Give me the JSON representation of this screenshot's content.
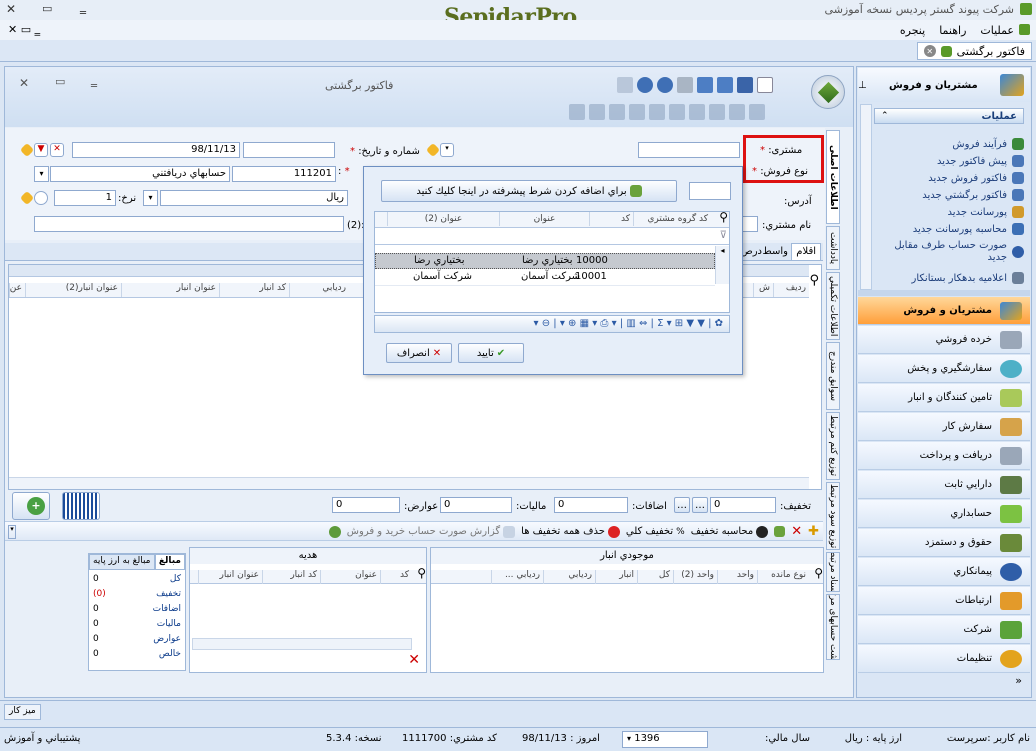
{
  "app": {
    "brand": "SepidarPro",
    "window_title": "شرکت پیوند گستر پردیس نسخه آموزشی",
    "menu": [
      "عملیات",
      "راهنما",
      "پنجره"
    ],
    "doc_tab": "فاکتور برگشتی"
  },
  "form": {
    "title": "فاکتور برگشتی",
    "customer_label": "مشتری:",
    "sale_type_label": "نوع فروش:",
    "address_label": "آدرس:",
    "customer_name_label": "نام مشتري:",
    "number_date_label": "شماره و تاریخ:",
    "date": "98/11/13",
    "account_code": "111201",
    "account_name": "حسابهاي دريافتني",
    "currency": "ريال",
    "rate_label": "نرخ:",
    "rate": "1",
    "colon_lbl": ":(2)"
  },
  "tabs": {
    "items": "اقلام",
    "wasete": "واسط",
    "dars": "درص"
  },
  "grid": {
    "headers": [
      "رديف",
      "ش",
      "رديابي",
      "كد انبار",
      "عنوان انبار",
      "عنوان انبار(2)",
      "عن"
    ]
  },
  "popup": {
    "add_condition": "براي اضافه كردن شرط پيشرفته در اينجا كليك كنيد",
    "headers": [
      "كد گروه مشتري",
      "كد",
      "عنوان",
      "عنوان (2)"
    ],
    "rows": [
      {
        "code": "10000",
        "title": "بختياري رضا",
        "title2": "بختياري رضا"
      },
      {
        "code": "10001",
        "title": "شركت آسمان",
        "title2": "شركت آسمان"
      }
    ],
    "ok": "تاييد",
    "cancel": "انصراف"
  },
  "totals": {
    "discount_label": "تخفيف:",
    "discount": "0",
    "additions_label": "اضافات:",
    "additions": "0",
    "tax_label": "ماليات:",
    "tax": "0",
    "duties_label": "عوارض:",
    "duties": "0"
  },
  "actions": {
    "calc_discount": "محاسبه تخفيف",
    "total_discount": "تخفيف كلي",
    "remove_discounts": "حذف همه تخفيف ها",
    "report": "گزارش صورت حساب خريد و فروش"
  },
  "stock": {
    "title": "موجودي انبار",
    "headers": [
      "نوع مانده",
      "واحد",
      "واحد (2)",
      "كل",
      "انبار",
      "رديابي",
      "رديابي ..."
    ]
  },
  "gift": {
    "title": "هديه",
    "headers": [
      "كد",
      "عنوان",
      "كد انبار",
      "عنوان انبار"
    ]
  },
  "summary": {
    "tab1": "مبالغ",
    "tab2": "مبالغ به ارز پايه",
    "rows": [
      {
        "label": "كل",
        "value": "0"
      },
      {
        "label": "تخفيف",
        "value": "(0)"
      },
      {
        "label": "اضافات",
        "value": "0"
      },
      {
        "label": "ماليات",
        "value": "0"
      },
      {
        "label": "عوارض",
        "value": "0"
      },
      {
        "label": "خالص",
        "value": "0"
      }
    ]
  },
  "vertical_tabs": [
    "اطلاعات اصلی",
    "يادداشت",
    "اطلاعات تكميلي",
    "سوابق مندرج",
    "توزيع كنم مرتبط",
    "توزيع سود مرتبط",
    "اسناد مرتبط",
    "برگشت حسابهای مرتبط"
  ],
  "sidebar": {
    "header": "مشتريان و فروش",
    "ops_title": "عمليات",
    "ops": [
      "فرآيند فروش",
      "پيش فاكتور جديد",
      "فاكتور فروش جديد",
      "فاكتور برگشتي جديد",
      "پورسانت جديد",
      "محاسبه پورسانت جديد",
      "صورت حساب طرف مقابل جديد",
      "اعلاميه بدهكار بستانكار"
    ],
    "modules": [
      "مشتريان و فروش",
      "خرده فروشي",
      "سفارشگيري و پخش",
      "تامين كنندگان و انبار",
      "سفارش كار",
      "دريافت و پرداخت",
      "دارايي ثابت",
      "حسابداري",
      "حقوق و دستمزد",
      "پيمانكاري",
      "ارتباطات",
      "شركت",
      "تنظيمات"
    ]
  },
  "taskbar": {
    "desk": "ميز كار"
  },
  "status": {
    "user": "نام كاربر :سرپرست",
    "currency": "ارز پايه :  ريال",
    "fiscal_label": "سال مالي:",
    "fiscal": "1396",
    "today": "امروز :  98/11/13",
    "customer_code": "كد مشتري:  1111700",
    "version": "نسخه:  5.3.4",
    "support": "پشتيباني و آموزش"
  },
  "colors": {
    "accent": "#2b63b8",
    "highlight": "#ffa14a",
    "red": "#cc1111"
  }
}
